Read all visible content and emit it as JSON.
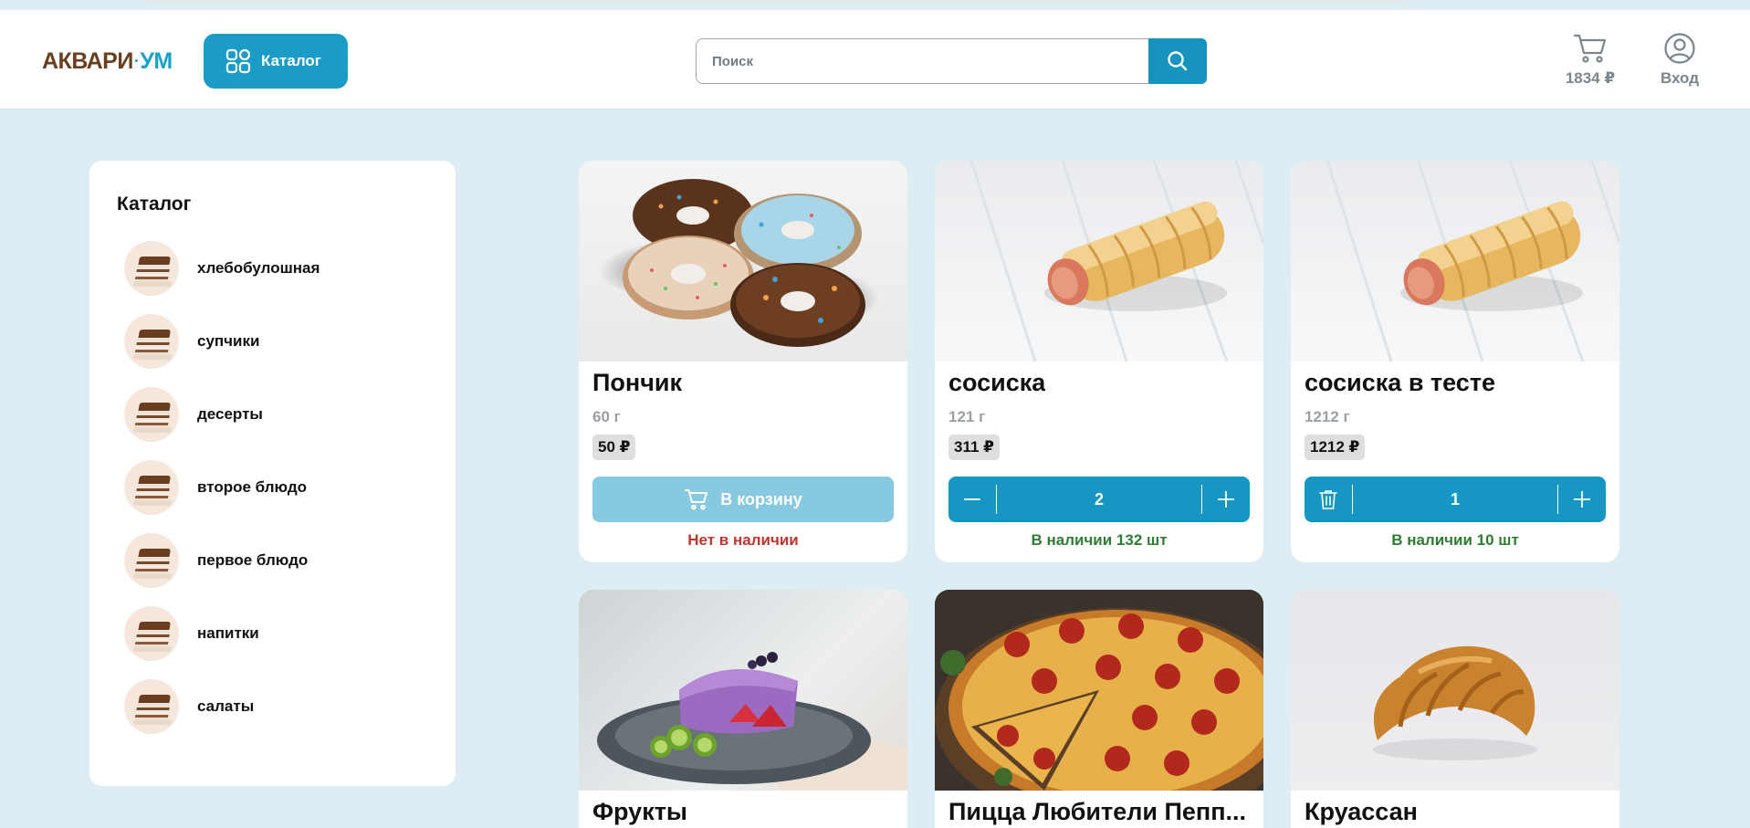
{
  "header": {
    "logo_part1": "АКВАРИ",
    "logo_dot": "·",
    "logo_part2": "УМ",
    "catalog_button_label": "Каталог",
    "search_placeholder": "Поиск",
    "cart_total": "1834 ₽",
    "login_label": "Вход",
    "icons": {
      "catalog": "grid-icon",
      "search": "search-icon",
      "cart": "cart-icon",
      "login": "user-circle-icon"
    }
  },
  "sidebar": {
    "title": "Каталог",
    "items": [
      {
        "label": "хлебобулошная"
      },
      {
        "label": "супчики"
      },
      {
        "label": "десерты"
      },
      {
        "label": "второе блюдо"
      },
      {
        "label": "первое блюдо"
      },
      {
        "label": "напитки"
      },
      {
        "label": "салаты"
      }
    ]
  },
  "products": [
    {
      "name": "Пончик",
      "weight": "60 г",
      "price": "50 ₽",
      "action": "add",
      "add_label": "В корзину",
      "stock": "Нет в наличии",
      "stock_status": "out"
    },
    {
      "name": "сосиска",
      "weight": "121 г",
      "price": "311 ₽",
      "action": "stepper",
      "quantity": "2",
      "left_icon": "minus-icon",
      "stock": "В наличии 132 шт",
      "stock_status": "in"
    },
    {
      "name": "сосиска в тесте",
      "weight": "1212 г",
      "price": "1212 ₽",
      "action": "stepper",
      "quantity": "1",
      "left_icon": "trash-icon",
      "stock": "В наличии 10 шт",
      "stock_status": "in"
    },
    {
      "name": "Фрукты"
    },
    {
      "name": "Пицца Любители Пепп..."
    },
    {
      "name": "Круассан"
    }
  ],
  "colors": {
    "accent": "#1a9cc6",
    "page_bg": "#ddedf3",
    "out_of_stock": "#c0352d",
    "in_stock": "#2f7d32"
  }
}
